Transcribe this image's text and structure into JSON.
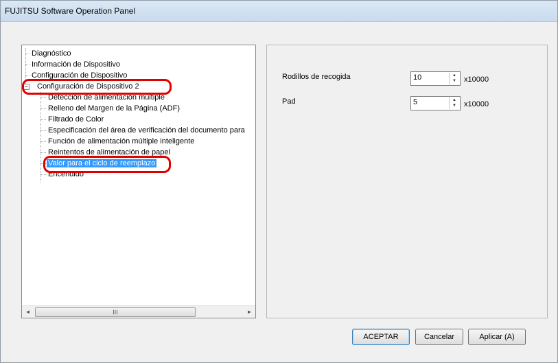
{
  "window": {
    "title": "FUJITSU Software Operation Panel"
  },
  "tree": {
    "items": [
      {
        "label": "Diagnóstico",
        "level": 0
      },
      {
        "label": "Información de Dispositivo",
        "level": 0
      },
      {
        "label": "Configuración de Dispositivo",
        "level": 0
      },
      {
        "label": "Configuración de Dispositivo 2",
        "level": 0,
        "expanded": true
      },
      {
        "label": "Detección de alimentación múltiple",
        "level": 1
      },
      {
        "label": "Relleno del Margen de la Página (ADF)",
        "level": 1
      },
      {
        "label": "Filtrado de Color",
        "level": 1
      },
      {
        "label": "Especificación del área de verificación del documento para",
        "level": 1
      },
      {
        "label": "Función de alimentación múltiple inteligente",
        "level": 1
      },
      {
        "label": "Reintentos de alimentación de papel",
        "level": 1
      },
      {
        "label": "Valor para el ciclo de reemplazo",
        "level": 1,
        "selected": true
      },
      {
        "label": "Encendido",
        "level": 1
      }
    ],
    "expander_symbol": "−",
    "scroll_left_icon": "◄",
    "scroll_right_icon": "►",
    "scroll_thumb_grip": "III"
  },
  "settings": {
    "rows": [
      {
        "label": "Rodillos de recogida",
        "value": "10",
        "unit": "x10000"
      },
      {
        "label": "Pad",
        "value": "5",
        "unit": "x10000"
      }
    ],
    "spin_up_icon": "▲",
    "spin_down_icon": "▼"
  },
  "buttons": {
    "ok": "ACEPTAR",
    "cancel": "Cancelar",
    "apply": "Aplicar (A)"
  },
  "colors": {
    "highlight_ring": "#e00000",
    "selection": "#3399ff"
  }
}
